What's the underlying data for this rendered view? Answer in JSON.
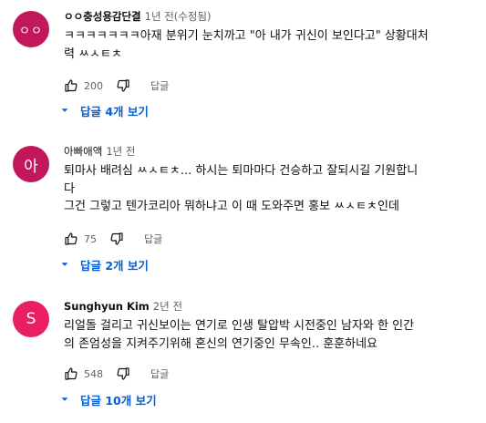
{
  "comments": [
    {
      "avatar_letter": "ㅇㅇ",
      "avatar_color": "#c2185b",
      "author": "ㅇㅇ충성용감단결",
      "time": "1년 전(수정됨)",
      "text": "ㅋㅋㅋㅋㅋㅋㅋ아재 분위기 눈치까고 \"아 내가 귀신이 보인다고\" 상황대처\n력 ㅆㅅㅌㅊ",
      "likes": "200",
      "reply_label": "답글",
      "replies_label": "답글 4개 보기"
    },
    {
      "avatar_letter": "아",
      "avatar_color": "#c2185b",
      "author": "아빠애액",
      "time": "1년 전",
      "text": "퇴마사 배려심 ㅆㅅㅌㅊ... 하시는 퇴마마다 건승하고 잘되시길 기원합니\n다\n그건 그렇고 텐가코리아 뭐하냐고 이 때 도와주면 홍보 ㅆㅅㅌㅊ인데",
      "likes": "75",
      "reply_label": "답글",
      "replies_label": "답글 2개 보기"
    },
    {
      "avatar_letter": "S",
      "avatar_color": "#e91e63",
      "author": "Sunghyun Kim",
      "time": "2년 전",
      "text": "리얼돌 걸리고 귀신보이는 연기로 인생 탈압박 시전중인 남자와 한 인간\n의 존엄성을 지켜주기위해 혼신의 연기중인 무속인.. 훈훈하네요",
      "likes": "548",
      "reply_label": "답글",
      "replies_label": "답글 10개 보기"
    }
  ],
  "colors": {
    "link": "#065fd4",
    "secondary": "#606060"
  },
  "icons": {
    "like": "thumbs-up-icon",
    "dislike": "thumbs-down-icon",
    "expand": "caret-down-icon"
  }
}
